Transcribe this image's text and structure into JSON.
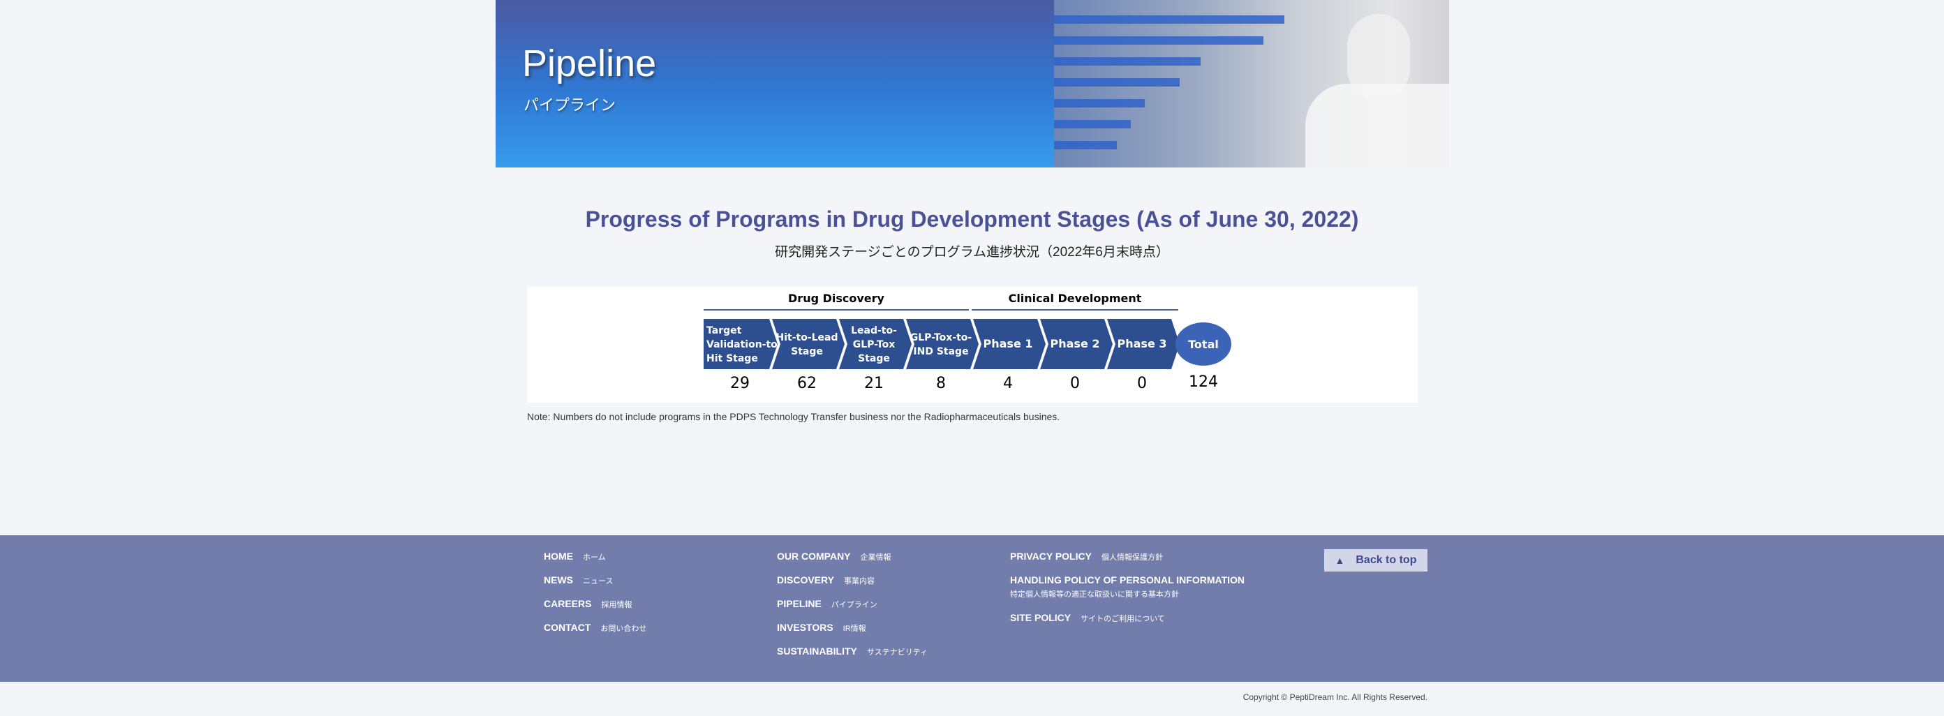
{
  "hero": {
    "title": "Pipeline",
    "subtitle": "パイプライン"
  },
  "section": {
    "title": "Progress of Programs in Drug Development Stages (As of June 30, 2022)",
    "subtitle": "研究開発ステージごとのプログラム進捗状況（2022年6月末時点）"
  },
  "pipeline": {
    "groups": [
      "Drug Discovery",
      "Clinical Development"
    ],
    "stages": [
      {
        "lines": [
          "Target",
          "Validation-to-",
          "Hit Stage"
        ],
        "count": "29"
      },
      {
        "lines": [
          "Hit-to-Lead",
          "Stage"
        ],
        "count": "62"
      },
      {
        "lines": [
          "Lead-to-",
          "GLP-Tox",
          "Stage"
        ],
        "count": "21"
      },
      {
        "lines": [
          "GLP-Tox-to-",
          "IND Stage"
        ],
        "count": "8"
      },
      {
        "lines": [
          "Phase 1"
        ],
        "count": "4"
      },
      {
        "lines": [
          "Phase 2"
        ],
        "count": "0"
      },
      {
        "lines": [
          "Phase 3"
        ],
        "count": "0"
      }
    ],
    "total": {
      "label": "Total",
      "count": "124"
    },
    "colors": {
      "stage": "#2e4f8f",
      "total": "#3b63b7",
      "group_line": "#4d6196"
    }
  },
  "note": "Note: Numbers do not include programs in the PDPS Technology Transfer business nor the Radiopharmaceuticals busines.",
  "footer": {
    "col1": [
      {
        "en": "Home",
        "jp": "ホーム"
      },
      {
        "en": "News",
        "jp": "ニュース"
      },
      {
        "en": "Careers",
        "jp": "採用情報"
      },
      {
        "en": "Contact",
        "jp": "お問い合わせ"
      }
    ],
    "col2": [
      {
        "en": "Our Company",
        "jp": "企業情報"
      },
      {
        "en": "Discovery",
        "jp": "事業内容"
      },
      {
        "en": "Pipeline",
        "jp": "パイプライン"
      },
      {
        "en": "Investors",
        "jp": "IR情報"
      },
      {
        "en": "Sustainability",
        "jp": "サステナビリティ"
      }
    ],
    "col3": [
      {
        "en": "Privacy Policy",
        "jp": "個人情報保護方針"
      },
      {
        "en": "Handling Policy of Personal Information",
        "jp": "特定個人情報等の適正な取扱いに関する基本方針"
      },
      {
        "en": "Site Policy",
        "jp": "サイトのご利用について"
      }
    ],
    "back_to_top": "Back to top",
    "copyright": "Copyright © PeptiDream Inc. All Rights Reserved.",
    "bg_color": "#727dac"
  }
}
